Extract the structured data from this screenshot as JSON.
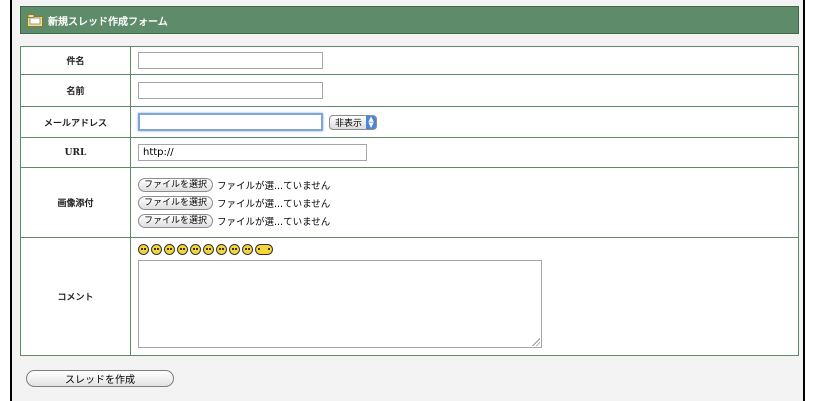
{
  "form": {
    "title": "新規スレッド作成フォーム",
    "rows": {
      "subject": {
        "label": "件名",
        "value": ""
      },
      "name": {
        "label": "名前",
        "value": ""
      },
      "email": {
        "label": "メールアドレス",
        "value": "",
        "visibility": "非表示"
      },
      "url": {
        "label": "URL",
        "value": "http://"
      },
      "image": {
        "label": "画像添付",
        "files": [
          {
            "button": "ファイルを選択",
            "status": "ファイルが選...ていません"
          },
          {
            "button": "ファイルを選択",
            "status": "ファイルが選...ていません"
          },
          {
            "button": "ファイルを選択",
            "status": "ファイルが選...ていません"
          }
        ]
      },
      "comment": {
        "label": "コメント",
        "value": "",
        "emoticons": [
          "sunglasses-face",
          "smile-face",
          "surprised-face",
          "confused-face",
          "grin-face",
          "happy-face",
          "laugh-face",
          "sad-face",
          "wink-face",
          "tongue-face"
        ]
      }
    },
    "submit_label": "スレッドを作成"
  },
  "colors": {
    "header_green": "#5e8c6a",
    "border_green": "#5e8c6a",
    "focus_blue": "#7ea6d8"
  }
}
